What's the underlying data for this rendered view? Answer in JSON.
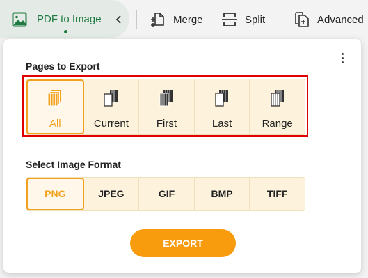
{
  "toolbar": {
    "active_tab": {
      "label": "PDF to Image",
      "icon": "image-icon"
    },
    "collapse_icon": "chevron-left-icon",
    "tools": [
      {
        "label": "Merge",
        "icon": "merge-icon"
      },
      {
        "label": "Split",
        "icon": "split-icon"
      },
      {
        "label": "Advanced",
        "icon": "add-file-icon"
      }
    ]
  },
  "panel": {
    "menu_icon": "more-vertical-icon",
    "pages_title": "Pages to Export",
    "pages": [
      {
        "label": "All",
        "icon": "all-pages-icon",
        "selected": true
      },
      {
        "label": "Current",
        "icon": "current-page-icon",
        "selected": false
      },
      {
        "label": "First",
        "icon": "first-page-icon",
        "selected": false
      },
      {
        "label": "Last",
        "icon": "last-page-icon",
        "selected": false
      },
      {
        "label": "Range",
        "icon": "range-pages-icon",
        "selected": false
      }
    ],
    "format_title": "Select Image Format",
    "formats": [
      {
        "label": "PNG",
        "selected": true
      },
      {
        "label": "JPEG",
        "selected": false
      },
      {
        "label": "GIF",
        "selected": false
      },
      {
        "label": "BMP",
        "selected": false
      },
      {
        "label": "TIFF",
        "selected": false
      }
    ],
    "export_label": "EXPORT"
  },
  "colors": {
    "accent": "#f2a21e",
    "export_button": "#f89c0e",
    "tab_green": "#1e7a40",
    "highlight_red": "#e00000",
    "option_bg": "#fdf3dc"
  }
}
